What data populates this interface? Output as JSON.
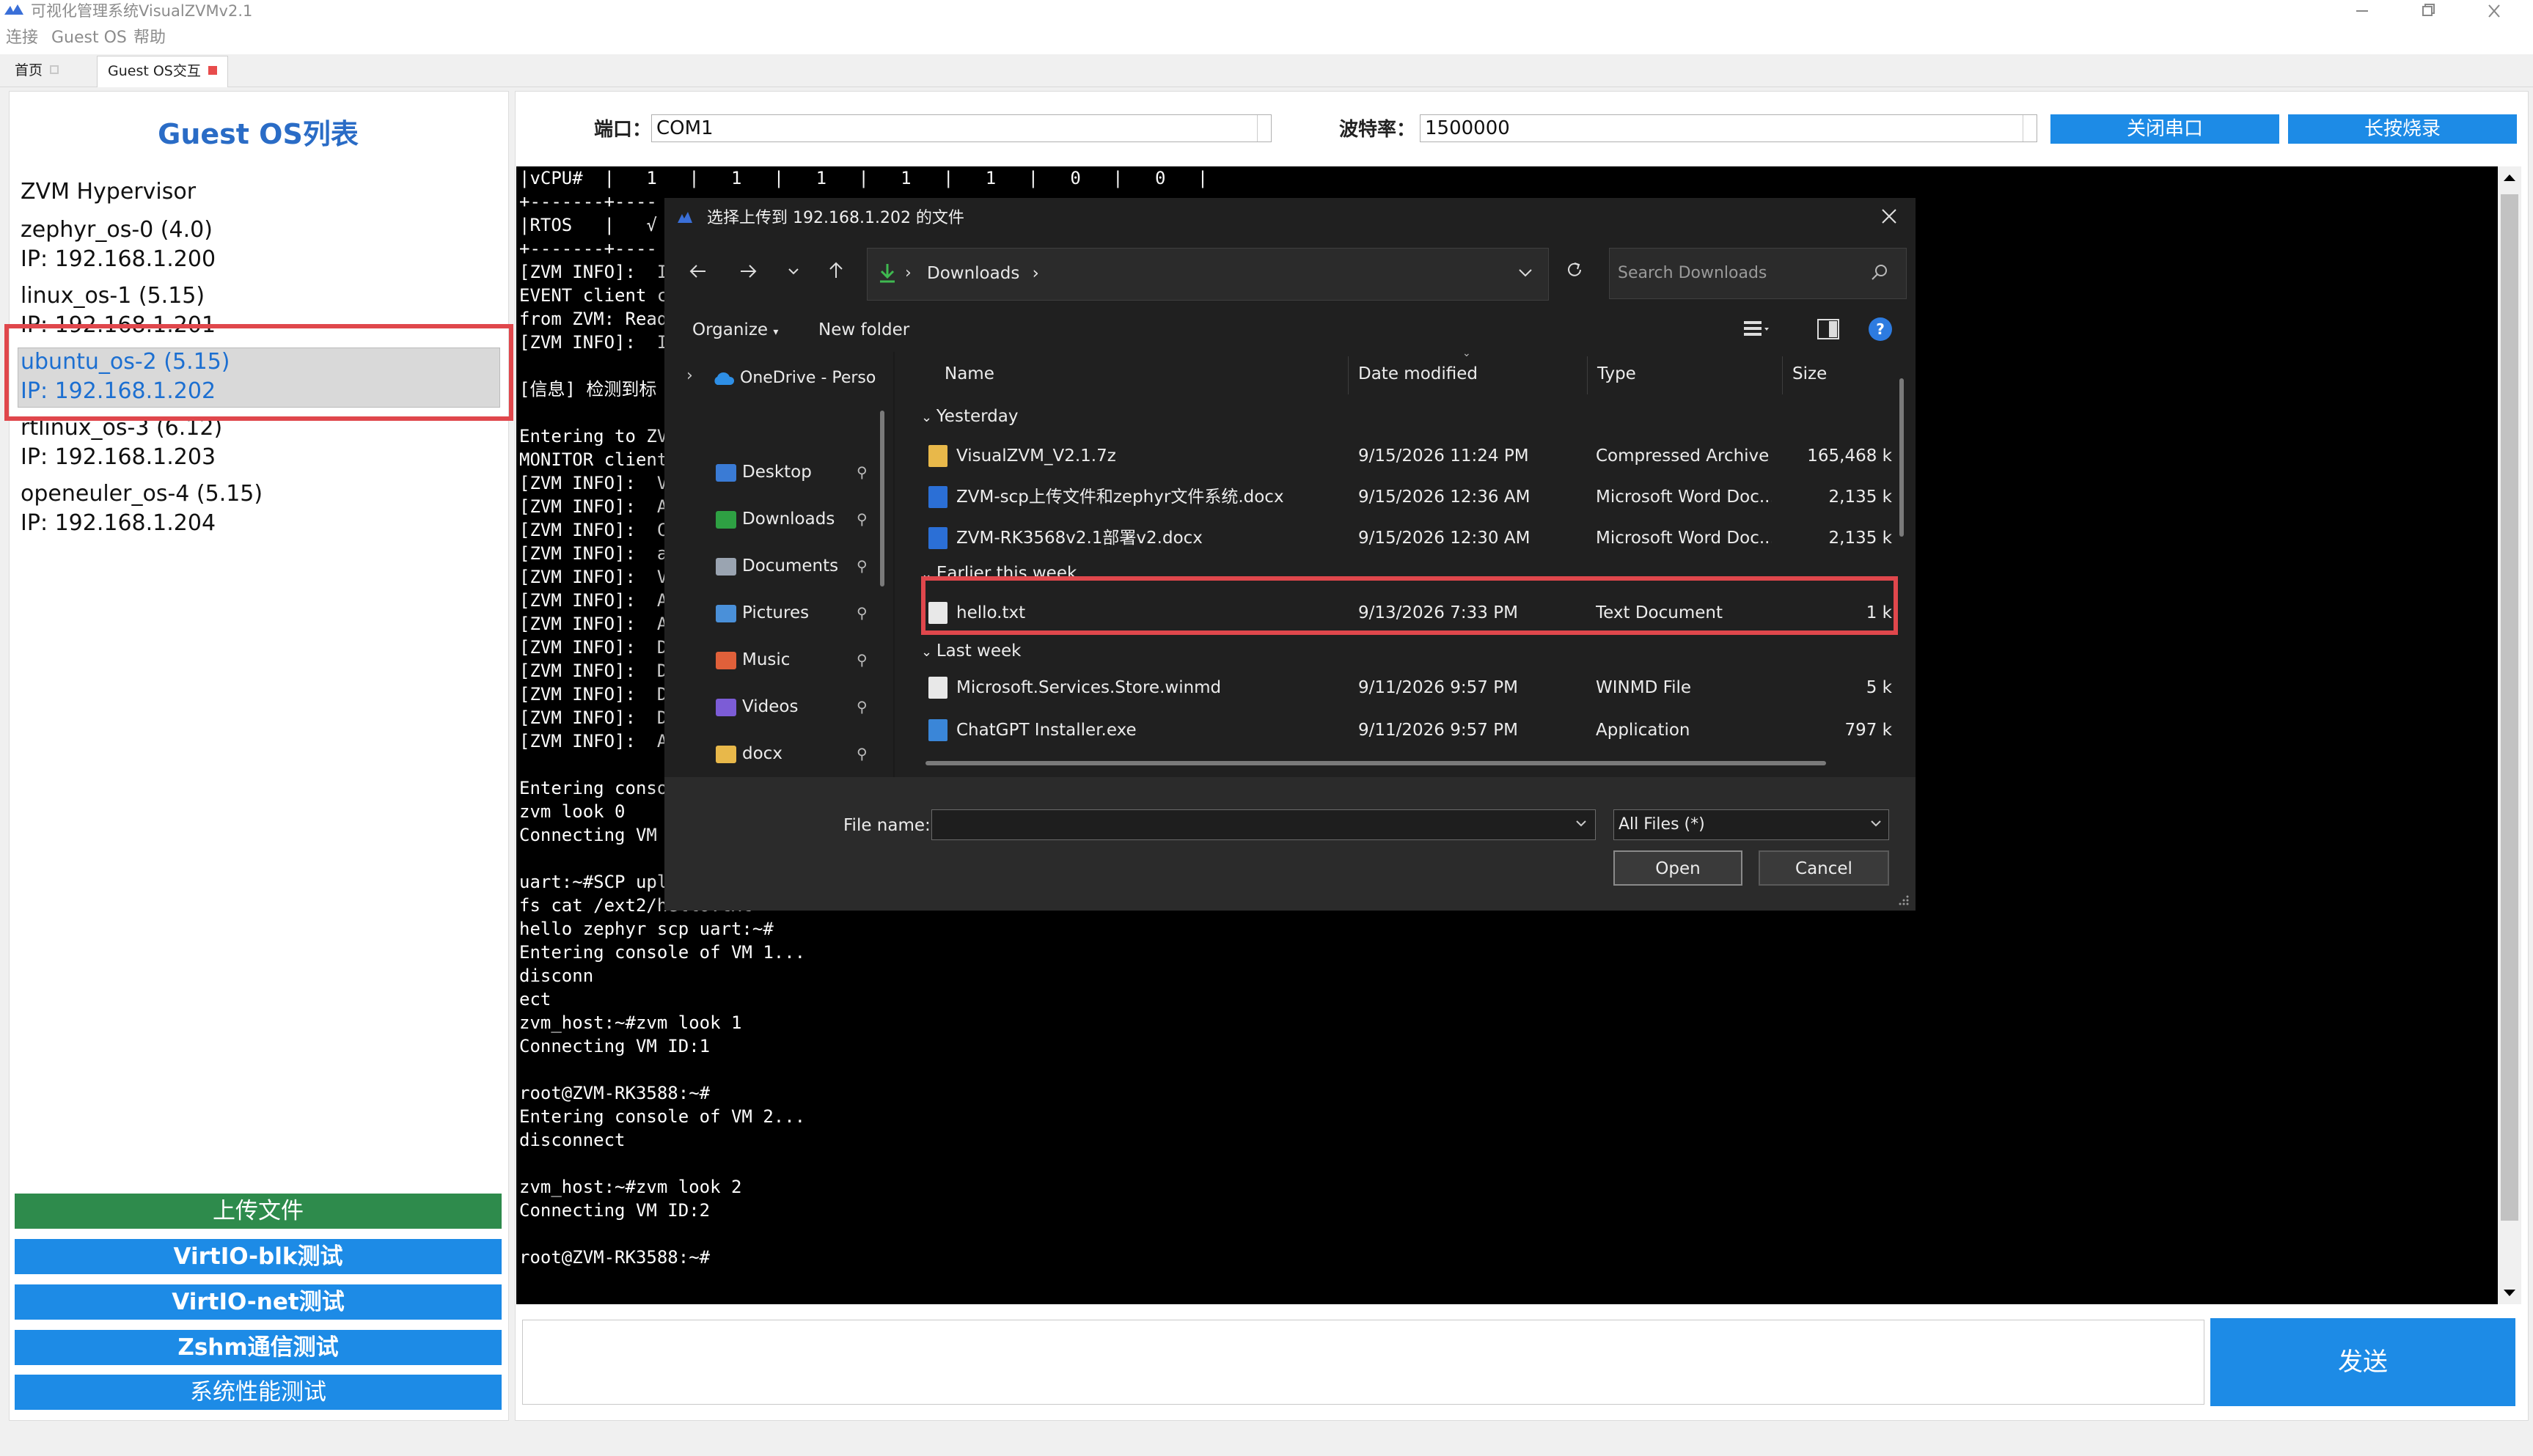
{
  "window": {
    "title": "可视化管理系统VisualZVMv2.1"
  },
  "menu": [
    "连接",
    "Guest OS",
    "帮助"
  ],
  "tabs": [
    {
      "label": "首页"
    },
    {
      "label": "Guest OS交互"
    }
  ],
  "left_panel": {
    "title": "Guest OS列表",
    "hypervisor": "ZVM Hypervisor",
    "guests": [
      {
        "name": "zephyr_os-0 (4.0)",
        "ip": "IP: 192.168.1.200"
      },
      {
        "name": "linux_os-1 (5.15)",
        "ip": "IP: 192.168.1.201"
      },
      {
        "name": "ubuntu_os-2 (5.15)",
        "ip": "IP: 192.168.1.202"
      },
      {
        "name": "rtlinux_os-3 (6.12)",
        "ip": "IP: 192.168.1.203"
      },
      {
        "name": "openeuler_os-4 (5.15)",
        "ip": "IP: 192.168.1.204"
      }
    ],
    "selected_index": 2,
    "buttons": [
      "上传文件",
      "VirtIO-blk测试",
      "VirtIO-net测试",
      "Zshm通信测试",
      "系统性能测试"
    ]
  },
  "config": {
    "port_label": "端口：",
    "port_value": "COM1",
    "baud_label": "波特率：",
    "baud_value": "1500000",
    "close_port_button": "关闭串口",
    "long_press_button": "长按烧录"
  },
  "terminal": {
    "text": "|vCPU#  |   1   |   1   |   1   |   1   |   1   |   0   |   0   |\n+-------+----\n|RTOS   |   √\n+-------+----\n[ZVM INFO]:  I\nEVENT client c\nfrom ZVM: Read\n[ZVM INFO]:  I\n\n[信息] 检测到标\n\nEntering to ZV\nMONITOR client\n[ZVM INFO]:  V\n[ZVM INFO]:  A\n[ZVM INFO]:  C\n[ZVM INFO]:  a\n[ZVM INFO]:  V\n[ZVM INFO]:  A\n[ZVM INFO]:  A\n[ZVM INFO]:  D\n[ZVM INFO]:  D\n[ZVM INFO]:  D\n[ZVM INFO]:  D\n[ZVM INFO]:  A\n\nEntering conso\nzvm look 0\nConnecting VM \n\nuart:~#SCP upload complete: bytes=17\nfs cat /ext2/hello.txt\nhello zephyr scp uart:~#\nEntering console of VM 1...\ndisconn\nect\nzvm_host:~#zvm look 1\nConnecting VM ID:1\n\nroot@ZVM-RK3588:~#\nEntering console of VM 2...\ndisconnect\n\nzvm_host:~#zvm look 2\nConnecting VM ID:2\n\nroot@ZVM-RK3588:~#"
  },
  "send_button": "发送",
  "dialog": {
    "title": "选择上传到 192.168.1.202 的文件",
    "address": [
      "Downloads",
      "›"
    ],
    "search_placeholder": "Search Downloads",
    "organize": "Organize",
    "new_folder": "New folder",
    "onedrive": "OneDrive - Perso",
    "nav_items": [
      {
        "label": "Desktop",
        "icon": "desktop-icon",
        "color": "#3a7bd5"
      },
      {
        "label": "Downloads",
        "icon": "download-icon",
        "color": "#2ea043"
      },
      {
        "label": "Documents",
        "icon": "documents-icon",
        "color": "#9aa4b1"
      },
      {
        "label": "Pictures",
        "icon": "pictures-icon",
        "color": "#4a90d9"
      },
      {
        "label": "Music",
        "icon": "music-icon",
        "color": "#e0603a"
      },
      {
        "label": "Videos",
        "icon": "videos-icon",
        "color": "#7c5cd6"
      },
      {
        "label": "docx",
        "icon": "folder-icon",
        "color": "#e8b84a"
      }
    ],
    "columns": {
      "name": "Name",
      "date": "Date modified",
      "type": "Type",
      "size": "Size"
    },
    "groups": [
      {
        "label": "Yesterday",
        "files": [
          {
            "name": "VisualZVM_V2.1.7z",
            "date": "9/15/2026 11:24 PM",
            "type": "Compressed Archive ...",
            "size": "165,468 k",
            "icon": "archive-icon"
          },
          {
            "name": "ZVM-scp上传文件和zephyr文件系统.docx",
            "date": "9/15/2026 12:36 AM",
            "type": "Microsoft Word Doc...",
            "size": "2,135 k",
            "icon": "word-icon"
          },
          {
            "name": "ZVM-RK3568v2.1部署v2.docx",
            "date": "9/15/2026 12:30 AM",
            "type": "Microsoft Word Doc...",
            "size": "2,135 k",
            "icon": "word-icon"
          }
        ]
      },
      {
        "label": "Earlier this week",
        "files": [
          {
            "name": "hello.txt",
            "date": "9/13/2026 7:33 PM",
            "type": "Text Document",
            "size": "1 k",
            "icon": "text-file-icon"
          }
        ]
      },
      {
        "label": "Last week",
        "files": [
          {
            "name": "Microsoft.Services.Store.winmd",
            "date": "9/11/2026 9:57 PM",
            "type": "WINMD File",
            "size": "5 k",
            "icon": "file-icon"
          },
          {
            "name": "ChatGPT Installer.exe",
            "date": "9/11/2026 9:57 PM",
            "type": "Application",
            "size": "797 k",
            "icon": "installer-icon"
          }
        ]
      }
    ],
    "file_name_label": "File name:",
    "file_name_value": "",
    "filter_value": "All Files (*)",
    "open_button": "Open",
    "cancel_button": "Cancel"
  }
}
